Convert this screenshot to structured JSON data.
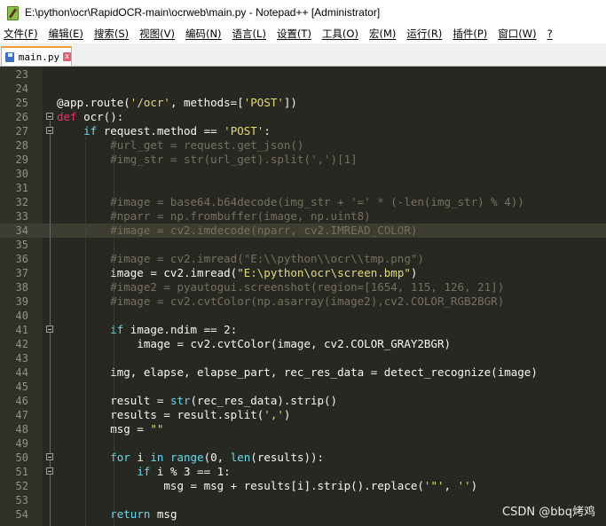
{
  "window": {
    "title": "E:\\python\\ocr\\RapidOCR-main\\ocrweb\\main.py - Notepad++ [Administrator]"
  },
  "menu": [
    "文件(F)",
    "编辑(E)",
    "搜索(S)",
    "视图(V)",
    "编码(N)",
    "语言(L)",
    "设置(T)",
    "工具(O)",
    "宏(M)",
    "运行(R)",
    "插件(P)",
    "窗口(W)",
    "?"
  ],
  "tab": {
    "label": "main.py",
    "close": "x"
  },
  "code_lines": [
    {
      "n": "23",
      "text": ""
    },
    {
      "n": "24",
      "text": ""
    },
    {
      "n": "25",
      "text": "@app.route('/ocr', methods=['POST'])"
    },
    {
      "n": "26",
      "text": "def ocr():"
    },
    {
      "n": "27",
      "text": "    if request.method == 'POST':"
    },
    {
      "n": "28",
      "text": "        #url_get = request.get_json()"
    },
    {
      "n": "29",
      "text": "        #img_str = str(url_get).split(',')[1]"
    },
    {
      "n": "30",
      "text": ""
    },
    {
      "n": "31",
      "text": ""
    },
    {
      "n": "32",
      "text": "        #image = base64.b64decode(img_str + '=' * (-len(img_str) % 4))"
    },
    {
      "n": "33",
      "text": "        #nparr = np.frombuffer(image, np.uint8)"
    },
    {
      "n": "34",
      "text": "        #image = cv2.imdecode(nparr, cv2.IMREAD_COLOR)"
    },
    {
      "n": "35",
      "text": ""
    },
    {
      "n": "36",
      "text": "        #image = cv2.imread(\"E:\\\\python\\\\ocr\\\\tmp.png\")"
    },
    {
      "n": "37",
      "text": "        image = cv2.imread(\"E:\\python\\ocr\\screen.bmp\")"
    },
    {
      "n": "38",
      "text": "        #image2 = pyautogui.screenshot(region=[1654, 115, 126, 21])"
    },
    {
      "n": "39",
      "text": "        #image = cv2.cvtColor(np.asarray(image2),cv2.COLOR_RGB2BGR)"
    },
    {
      "n": "40",
      "text": ""
    },
    {
      "n": "41",
      "text": "        if image.ndim == 2:"
    },
    {
      "n": "42",
      "text": "            image = cv2.cvtColor(image, cv2.COLOR_GRAY2BGR)"
    },
    {
      "n": "43",
      "text": ""
    },
    {
      "n": "44",
      "text": "        img, elapse, elapse_part, rec_res_data = detect_recognize(image)"
    },
    {
      "n": "45",
      "text": ""
    },
    {
      "n": "46",
      "text": "        result = str(rec_res_data).strip()"
    },
    {
      "n": "47",
      "text": "        results = result.split(',')"
    },
    {
      "n": "48",
      "text": "        msg = \"\""
    },
    {
      "n": "49",
      "text": ""
    },
    {
      "n": "50",
      "text": "        for i in range(0, len(results)):"
    },
    {
      "n": "51",
      "text": "            if i % 3 == 1:"
    },
    {
      "n": "52",
      "text": "                msg = msg + results[i].strip().replace('\"', '')"
    },
    {
      "n": "53",
      "text": ""
    },
    {
      "n": "54",
      "text": "        return msg"
    }
  ],
  "highlighted_line": "34",
  "watermark": "CSDN @bbq烤鸡",
  "colors": {
    "background": "#272822",
    "keyword": "#66d9ef",
    "string": "#e6db74",
    "comment": "#75715e",
    "tab_accent": "#f0a030"
  }
}
